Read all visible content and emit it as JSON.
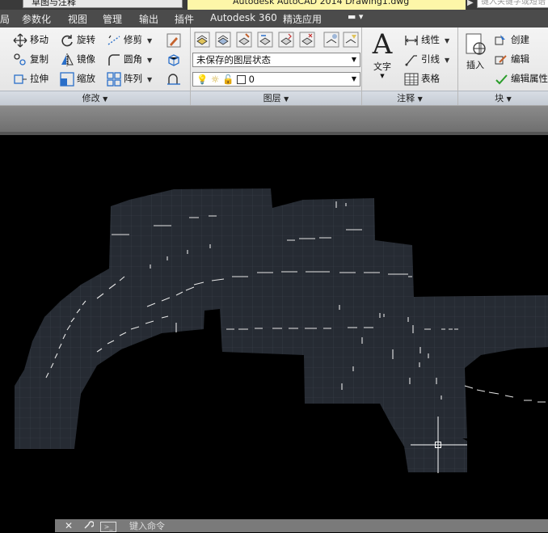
{
  "title_bar": {
    "workspace": "草图与注释",
    "document_title": "Autodesk AutoCAD 2014    Drawing1.dwg",
    "search_placeholder": "键入关键字或短语"
  },
  "menu": [
    "局",
    "参数化",
    "视图",
    "管理",
    "输出",
    "插件",
    "Autodesk 360",
    "精选应用"
  ],
  "ribbon": {
    "modify": {
      "title": "修改",
      "move": "移动",
      "rotate": "旋转",
      "trim": "修剪",
      "copy": "复制",
      "mirror": "镜像",
      "fillet": "圆角",
      "stretch": "拉伸",
      "scale": "缩放",
      "array": "阵列"
    },
    "layers": {
      "title": "图层",
      "layer_state": "未保存的图层状态",
      "current_layer": "0"
    },
    "annotation": {
      "title": "注释",
      "text": "文字",
      "linear": "线性",
      "leader": "引线",
      "table": "表格"
    },
    "block": {
      "title": "块",
      "insert": "插入",
      "create": "创建",
      "edit": "编辑",
      "edit_attributes": "编辑属性"
    }
  },
  "command_line": {
    "placeholder": "键入命令"
  },
  "colors": {
    "drawing_background": "#000000",
    "map_fill": "#262b33",
    "grid_line": "#3b414c",
    "crosshair": "#ffffff"
  }
}
